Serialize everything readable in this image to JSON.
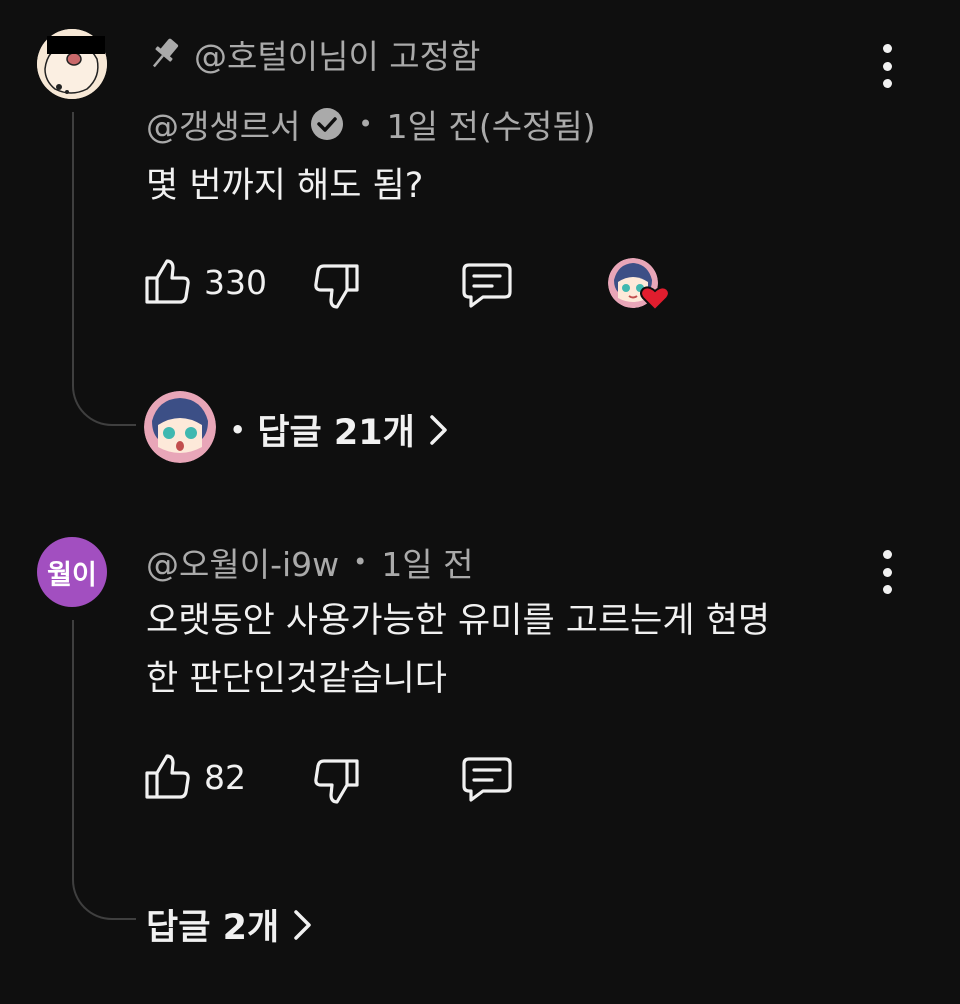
{
  "comments": [
    {
      "pinned_label": "@호털이님이 고정함",
      "author": "@갱생르서",
      "verified": true,
      "time": "1일 전(수정됨)",
      "text": "몇 번까지 해도 됨?",
      "likes": "330",
      "replies_label": "답글 21개",
      "creator_hearted": true,
      "icons": {
        "pin": "pin-icon",
        "like": "thumb-up-icon",
        "dislike": "thumb-down-icon",
        "reply": "reply-icon",
        "more": "more-vert-icon"
      }
    },
    {
      "avatar_text": "월이",
      "avatar_color": "#a24fc0",
      "author": "@오월이-i9w",
      "time": "1일 전",
      "text_line1": "오랫동안 사용가능한 유미를 고르는게 현명",
      "text_line2": "한 판단인것같습니다",
      "likes": "82",
      "replies_label": "답글 2개"
    }
  ],
  "separator": "•",
  "heart_color": "#e11d2e"
}
